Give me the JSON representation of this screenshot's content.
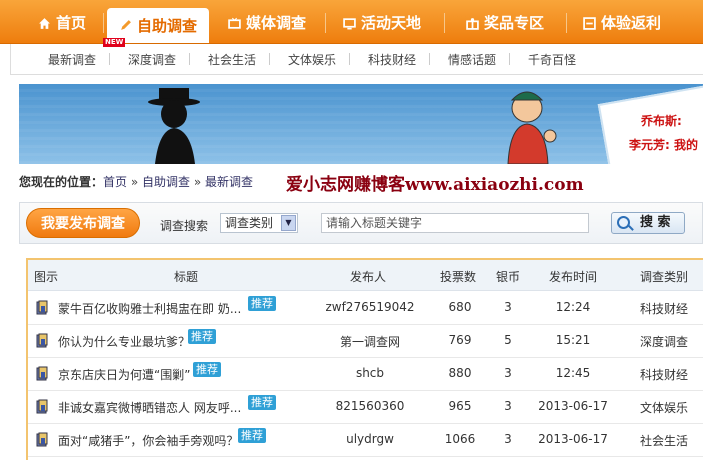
{
  "nav": {
    "items": [
      {
        "label": "首页",
        "icon": "home-icon"
      },
      {
        "label": "自助调查",
        "icon": "pencil-icon",
        "active": true
      },
      {
        "label": "媒体调查",
        "icon": "tv-icon"
      },
      {
        "label": "活动天地",
        "icon": "monitor-icon"
      },
      {
        "label": "奖品专区",
        "icon": "gift-icon"
      },
      {
        "label": "体验返利",
        "icon": "rebate-icon"
      }
    ]
  },
  "subnav": {
    "items": [
      "最新调查",
      "深度调查",
      "社会生活",
      "文体娱乐",
      "科技财经",
      "情感话题",
      "千奇百怪"
    ],
    "new_badge": "NEW"
  },
  "banner": {
    "text1": "乔布斯:",
    "text2": "李元芳: 我的"
  },
  "breadcrumb": {
    "prefix": "您现在的位置：",
    "home": "首页",
    "sep": "»",
    "section": "自助调查",
    "current": "最新调查"
  },
  "watermark": "爱小志网赚博客www.aixiaozhi.com",
  "search": {
    "publish_label": "我要发布调查",
    "label": "调查搜索",
    "category_value": "调查类别",
    "placeholder": "请输入标题关键字",
    "button_label": "搜 索"
  },
  "table": {
    "headers": {
      "icon": "图示",
      "title": "标题",
      "publisher": "发布人",
      "votes": "投票数",
      "coins": "银币",
      "time": "发布时间",
      "category": "调查类别"
    },
    "rows": [
      {
        "title": "蒙牛百亿收购雅士利揭盅在即 奶...",
        "tag": "推荐",
        "publisher": "zwf276519042",
        "votes": "680",
        "coins": "3",
        "time": "12:24",
        "category": "科技财经"
      },
      {
        "title": "你认为什么专业最坑爹？",
        "tag": "推荐",
        "publisher": "第一调查网",
        "votes": "769",
        "coins": "5",
        "time": "15:21",
        "category": "深度调查"
      },
      {
        "title": "京东店庆日为何遭“围剿”",
        "tag": "推荐",
        "publisher": "shcb",
        "votes": "880",
        "coins": "3",
        "time": "12:45",
        "category": "科技财经"
      },
      {
        "title": "非诚女嘉宾微博晒错恋人 网友呼...",
        "tag": "推荐",
        "publisher": "821560360",
        "votes": "965",
        "coins": "3",
        "time": "2013-06-17",
        "category": "文体娱乐"
      },
      {
        "title": "面对“咸猪手”，你会袖手旁观吗？",
        "tag": "推荐",
        "publisher": "ulydrgw",
        "votes": "1066",
        "coins": "3",
        "time": "2013-06-17",
        "category": "社会生活"
      }
    ]
  }
}
